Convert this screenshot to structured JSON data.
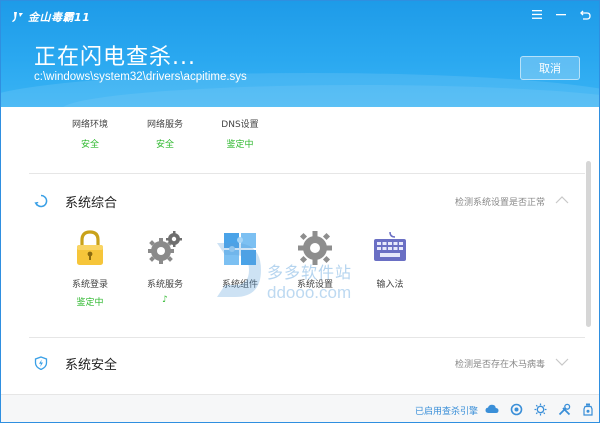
{
  "app": {
    "title": "金山毒霸11"
  },
  "header": {
    "scan_title": "正在闪电查杀...",
    "scan_path": "c:\\windows\\system32\\drivers\\acpitime.sys",
    "cancel_label": "取消"
  },
  "network": {
    "items": [
      {
        "label": "网络环境",
        "status": "安全"
      },
      {
        "label": "网络服务",
        "status": "安全"
      },
      {
        "label": "DNS设置",
        "status": "鉴定中"
      }
    ]
  },
  "sections": {
    "comprehensive": {
      "title": "系统综合",
      "desc": "检测系统设置是否正常",
      "icon": "refresh-circle-icon"
    },
    "security": {
      "title": "系统安全",
      "desc": "检测是否存在木马病毒",
      "icon": "shield-bolt-icon"
    }
  },
  "tiles": [
    {
      "label": "系统登录",
      "status": "鉴定中",
      "icon": "lock-icon"
    },
    {
      "label": "系统服务",
      "status": "♪",
      "icon": "gears-icon"
    },
    {
      "label": "系统组件",
      "status": "",
      "icon": "puzzle-icon"
    },
    {
      "label": "系统设置",
      "status": "",
      "icon": "gear-icon"
    },
    {
      "label": "输入法",
      "status": "",
      "icon": "keyboard-icon"
    }
  ],
  "watermark": {
    "text": "多多软件站",
    "url": "ddooo.com"
  },
  "footer": {
    "engine_label": "已启用查杀引擎",
    "tools": [
      "cloud-icon",
      "ring-icon",
      "sun-gear-icon",
      "tools-icon",
      "bottle-icon"
    ]
  },
  "colors": {
    "header": "#1e9be8",
    "safe": "#2eb82e",
    "link": "#3a8fd8"
  }
}
